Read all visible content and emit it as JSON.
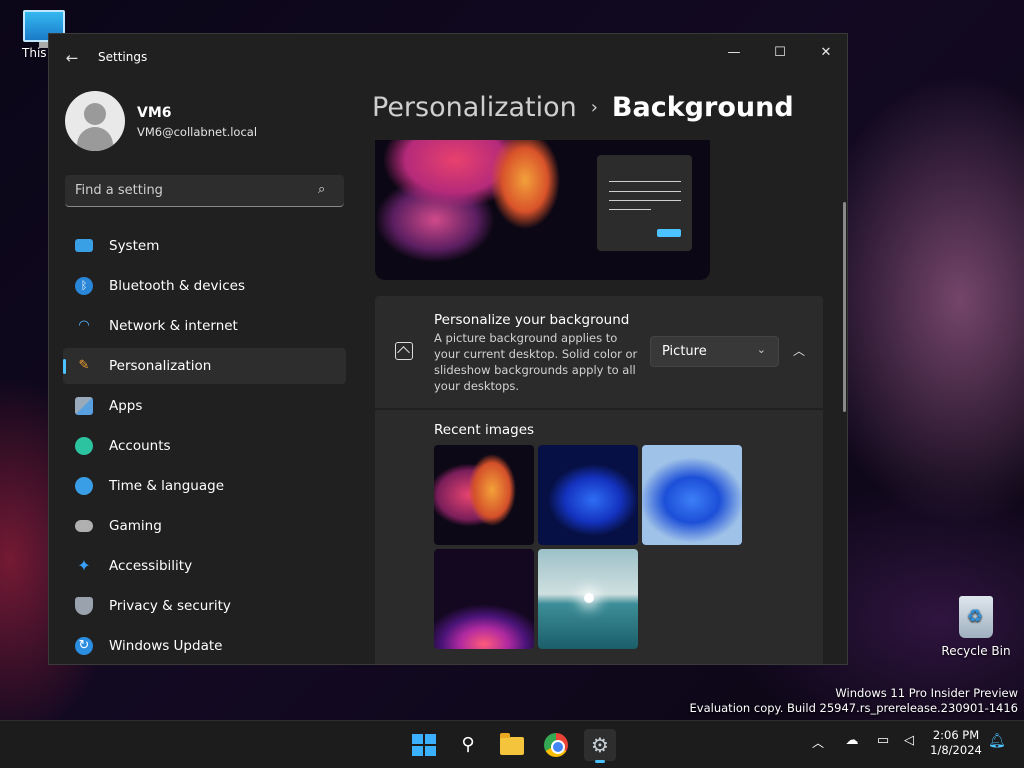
{
  "desktop": {
    "this_pc_label": "This PC",
    "recycle_bin_label": "Recycle Bin",
    "watermark_line1": "Windows 11 Pro Insider Preview",
    "watermark_line2": "Evaluation copy. Build 25947.rs_prerelease.230901-1416"
  },
  "window": {
    "title": "Settings",
    "minimize": "—",
    "maximize": "☐",
    "close": "✕",
    "back": "←"
  },
  "user": {
    "name": "VM6",
    "email": "VM6@collabnet.local"
  },
  "search": {
    "placeholder": "Find a setting",
    "icon": "⌕"
  },
  "nav": {
    "items": [
      {
        "label": "System",
        "icon": "system-icon"
      },
      {
        "label": "Bluetooth & devices",
        "icon": "bluetooth-icon"
      },
      {
        "label": "Network & internet",
        "icon": "wifi-icon"
      },
      {
        "label": "Personalization",
        "icon": "brush-icon",
        "active": true
      },
      {
        "label": "Apps",
        "icon": "apps-icon"
      },
      {
        "label": "Accounts",
        "icon": "account-icon"
      },
      {
        "label": "Time & language",
        "icon": "clock-globe-icon"
      },
      {
        "label": "Gaming",
        "icon": "gamepad-icon"
      },
      {
        "label": "Accessibility",
        "icon": "accessibility-icon"
      },
      {
        "label": "Privacy & security",
        "icon": "shield-icon"
      },
      {
        "label": "Windows Update",
        "icon": "update-icon"
      }
    ]
  },
  "header": {
    "parent": "Personalization",
    "separator": "›",
    "current": "Background"
  },
  "background_card": {
    "title": "Personalize your background",
    "description": "A picture background applies to your current desktop. Solid color or slideshow backgrounds apply to all your desktops.",
    "selected": "Picture",
    "chevron": "⌄",
    "expand": "︿"
  },
  "recent": {
    "title": "Recent images",
    "images": [
      "bloom-wallpaper",
      "blue-bloom-dark",
      "blue-bloom-light",
      "purple-glow",
      "lake-sunrise"
    ]
  },
  "taskbar": {
    "search_glyph": "⚲",
    "settings_glyph": "⚙",
    "tray_chevron": "︿",
    "time": "2:06 PM",
    "date": "1/8/2024"
  },
  "colors": {
    "accent": "#4cc2ff",
    "window_bg": "#202020",
    "card_bg": "#2b2b2b"
  }
}
